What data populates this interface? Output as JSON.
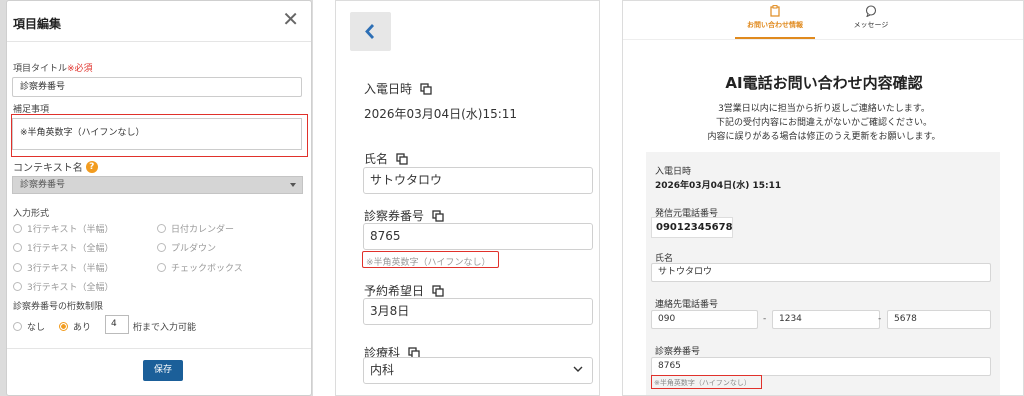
{
  "modal": {
    "title": "項目編集",
    "close": "✕",
    "item_title_label": "項目タイトル",
    "required": "※必須",
    "item_title_value": "診察券番号",
    "supplement_label": "補足事項",
    "supplement_value": "※半角英数字（ハイフンなし）",
    "context_label": "コンテキスト名",
    "help": "?",
    "context_value": "診察券番号",
    "input_format_label": "入力形式",
    "formats": [
      "1行テキスト（半幅）",
      "日付カレンダー",
      "1行テキスト（全幅）",
      "プルダウン",
      "3行テキスト（半幅）",
      "チェックボックス",
      "3行テキスト（全幅）"
    ],
    "digit_limit_label": "診察券番号の桁数制限",
    "none": "なし",
    "yes": "あり",
    "digit_value": "4",
    "digit_suffix": "桁まで入力可能",
    "save": "保存"
  },
  "mobile": {
    "back_icon": "chevron-left-icon",
    "call_datetime_label": "入電日時",
    "call_datetime_value": "2026年03月04日(水)15:11",
    "name_label": "氏名",
    "name_value": "サトウタロウ",
    "card_no_label": "診察券番号",
    "card_no_value": "8765",
    "card_no_note": "※半角英数字（ハイフンなし）",
    "desired_date_label": "予約希望日",
    "desired_date_value": "3月8日",
    "dept_label": "診療科",
    "dept_value": "内科"
  },
  "confirm": {
    "tab_inquiry": "お問い合わせ情報",
    "tab_message": "メッセージ",
    "title": "AI電話お問い合わせ内容確認",
    "msg1": "3営業日以内に担当から折り返しご連絡いたします。",
    "msg2": "下記の受付内容にお間違えがないかご確認ください。",
    "msg3": "内容に誤りがある場合は修正のうえ更新をお願いします。",
    "call_datetime_label": "入電日時",
    "call_datetime_value": "2026年03月04日(水) 15:11",
    "caller_phone_label": "発信元電話番号",
    "caller_phone_value": "09012345678",
    "name_label": "氏名",
    "name_value": "サトウタロウ",
    "contact_phone_label": "連絡先電話番号",
    "phone1": "090",
    "phone2": "1234",
    "phone3": "5678",
    "dash": "-",
    "card_no_label": "診察券番号",
    "card_no_value": "8765",
    "card_no_note": "※半角英数字（ハイフンなし）"
  },
  "colors": {
    "accent": "#e08a1e",
    "highlight": "#e0312b",
    "save": "#1b5f99",
    "help": "#f29c1f"
  }
}
